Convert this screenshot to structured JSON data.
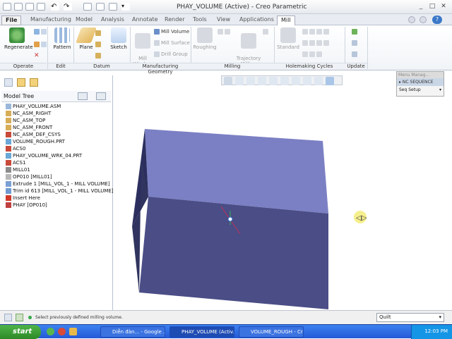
{
  "window": {
    "title": "PHAY_VOLUME (Active) - Creo Parametric"
  },
  "menu": {
    "tabs": [
      "File",
      "Manufacturing",
      "Model",
      "Analysis",
      "Annotate",
      "Render",
      "Tools",
      "View",
      "Applications",
      "Mill"
    ],
    "active": "Mill"
  },
  "ribbon": {
    "operate": {
      "regenerate": "Regenerate",
      "group": "Operate"
    },
    "edit": {
      "pattern": "Pattern",
      "group": "Edit"
    },
    "datum": {
      "plane": "Plane",
      "sketch": "Sketch",
      "group": "Datum"
    },
    "mfg": {
      "mill_window": "Mill\nWindow",
      "mill_volume": "Mill Volume",
      "mill_surface": "Mill Surface",
      "drill_group": "Drill Group",
      "group": "Manufacturing Geometry"
    },
    "milling": {
      "roughing": "Roughing",
      "trajectory": "Trajectory\nMilling",
      "group": "Milling"
    },
    "holemaking": {
      "standard": "Standard",
      "group": "Holemaking Cycles"
    },
    "update": {
      "group": "Update"
    }
  },
  "model_tree": {
    "title": "Model Tree",
    "items": [
      {
        "label": "PHAY_VOLUME.ASM",
        "icon": "assembly-icon",
        "expand": false
      },
      {
        "label": "NC_ASM_RIGHT",
        "icon": "datum-plane-icon",
        "expand": false
      },
      {
        "label": "NC_ASM_TOP",
        "icon": "datum-plane-icon",
        "expand": false
      },
      {
        "label": "NC_ASM_FRONT",
        "icon": "datum-plane-icon",
        "expand": false
      },
      {
        "label": "NC_ASM_DEF_CSYS",
        "icon": "csys-icon",
        "expand": false
      },
      {
        "label": "VOLUME_ROUGH.PRT",
        "icon": "part-icon",
        "expand": true
      },
      {
        "label": "ACS0",
        "icon": "csys-icon",
        "expand": false
      },
      {
        "label": "PHAY_VOLUME_WRK_04.PRT",
        "icon": "part-icon",
        "expand": true
      },
      {
        "label": "ACS1",
        "icon": "csys-icon",
        "expand": false
      },
      {
        "label": "MILL01",
        "icon": "machine-icon",
        "expand": false
      },
      {
        "label": "OP010 [MILL01]",
        "icon": "operation-icon",
        "expand": false
      },
      {
        "label": "Extrude 1 [MILL_VOL_1 - MILL VOLUME]",
        "icon": "extrude-icon",
        "expand": true
      },
      {
        "label": "Trim id 613 [MILL_VOL_1 - MILL VOLUME]",
        "icon": "trim-icon",
        "expand": true
      },
      {
        "label": "Insert Here",
        "icon": "insert-arrow-icon",
        "expand": false
      },
      {
        "label": "PHAY [OP010]",
        "icon": "sequence-icon",
        "expand": false
      }
    ]
  },
  "menu_manager": {
    "title": "Menu Manag...",
    "items": [
      "NC SEQUENCE",
      "Seq Setup"
    ]
  },
  "status": {
    "message": "Select previously defined milling volume.",
    "filter": "Quilt"
  },
  "taskbar": {
    "start": "start",
    "buttons": [
      "Diễn đàn... - Google ...",
      "PHAY_VOLUME (Activ...",
      "VOLUME_ROUGH - Cr..."
    ],
    "clock": "12:03 PM"
  },
  "colors": {
    "box_top": "#7b80c4",
    "box_front": "#4a4d86",
    "box_side": "#2c2f5e",
    "accent": "#2459d6"
  }
}
